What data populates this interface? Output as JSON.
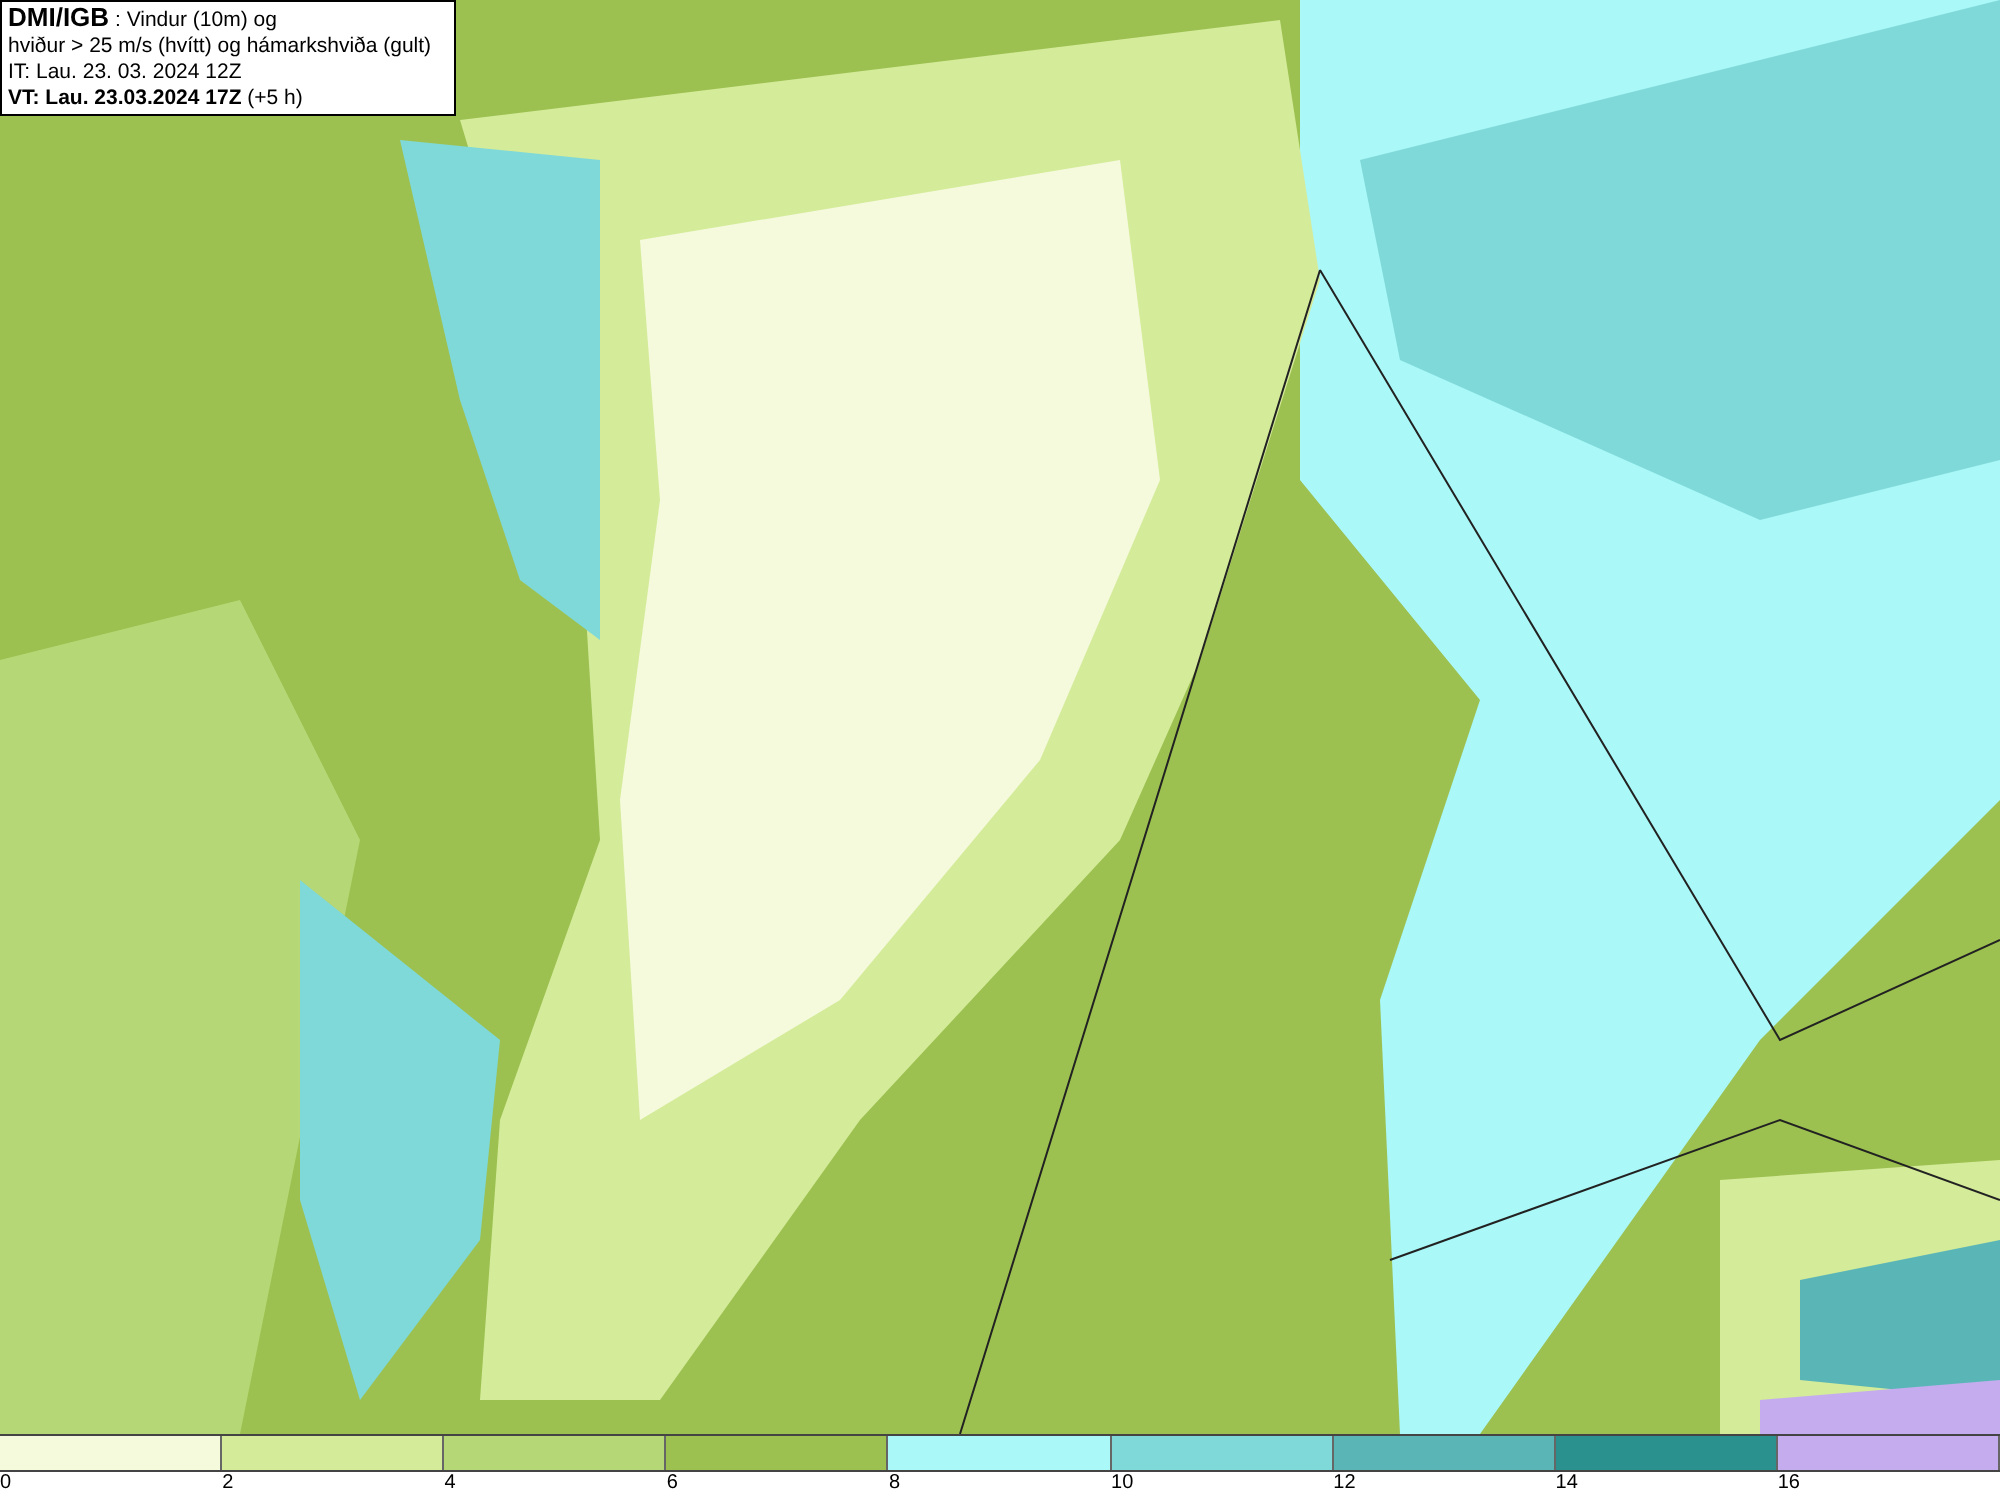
{
  "info_box": {
    "source": "DMI/IGB",
    "title": " : Vindur (10m) og",
    "subtitle": "hviður > 25 m/s (hvítt) og hámarkshviða (gult)",
    "issue_time": "IT: Lau. 23. 03. 2024 12Z",
    "valid_time": "VT: Lau. 23.03.2024 17Z",
    "offset": " (+5 h)"
  },
  "legend": {
    "segments": [
      {
        "color": "#f5fadc"
      },
      {
        "color": "#d4eb9a"
      },
      {
        "color": "#b6d775"
      },
      {
        "color": "#9cc150"
      },
      {
        "color": "#aaf8f8"
      },
      {
        "color": "#7fd9d9"
      },
      {
        "color": "#5ab6b6"
      },
      {
        "color": "#2a918f"
      },
      {
        "color": "#c4acef"
      }
    ],
    "ticks": [
      "0",
      "2",
      "4",
      "6",
      "8",
      "10",
      "12",
      "14",
      "16"
    ]
  }
}
